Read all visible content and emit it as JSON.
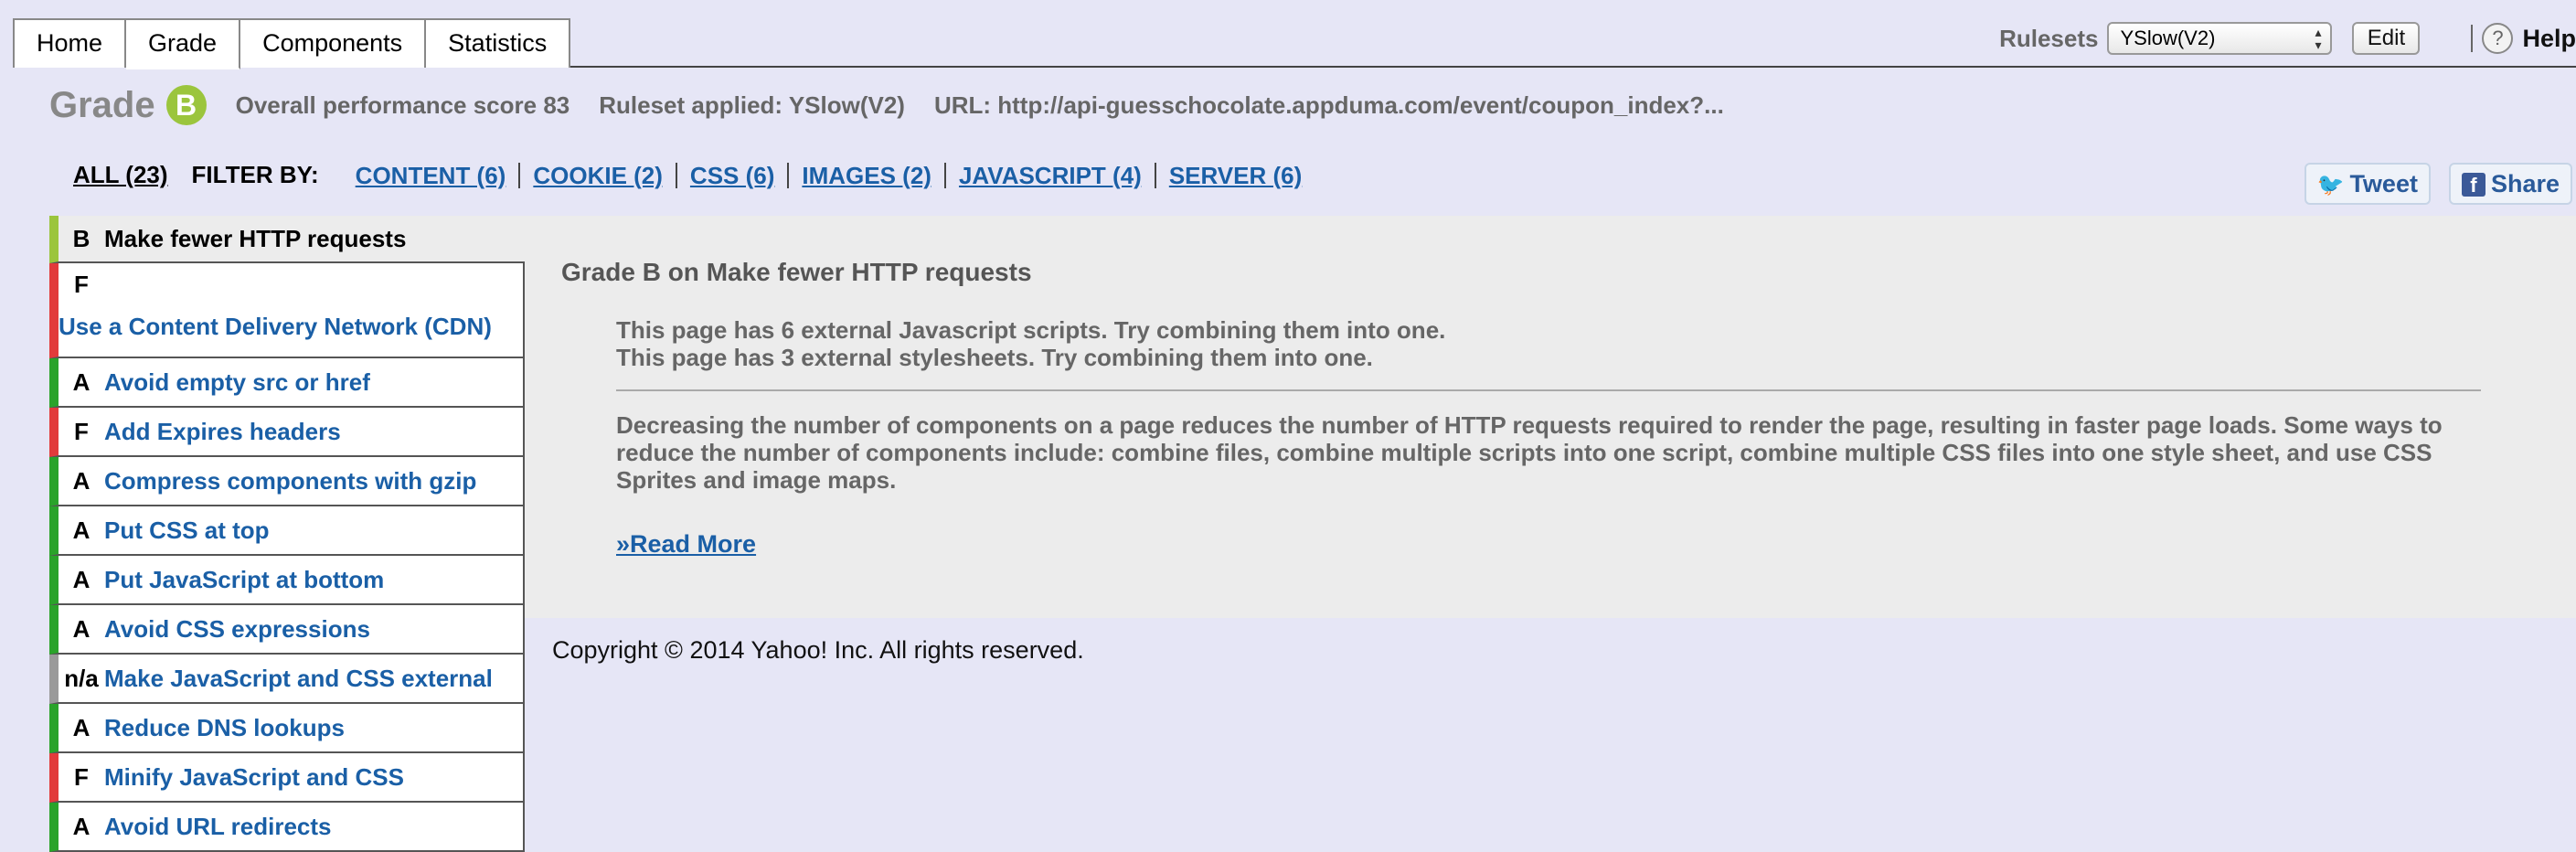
{
  "nav": {
    "tabs": [
      {
        "label": "Home"
      },
      {
        "label": "Grade"
      },
      {
        "label": "Components"
      },
      {
        "label": "Statistics"
      }
    ],
    "rulesets_label": "Rulesets",
    "ruleset_selected": "YSlow(V2)",
    "edit_label": "Edit",
    "help_icon": "?",
    "help_label": "Help"
  },
  "summary": {
    "grade_word": "Grade",
    "grade_letter": "B",
    "overall": "Overall performance score 83",
    "ruleset": "Ruleset applied: YSlow(V2)",
    "url": "URL: http://api-guesschocolate.appduma.com/event/coupon_index?..."
  },
  "filters": {
    "all": "ALL (23)",
    "filter_by": "FILTER BY:",
    "links": [
      {
        "label": "CONTENT (6)"
      },
      {
        "label": "COOKIE (2)"
      },
      {
        "label": "CSS (6)"
      },
      {
        "label": "IMAGES (2)"
      },
      {
        "label": "JAVASCRIPT (4)"
      },
      {
        "label": "SERVER (6)"
      }
    ]
  },
  "share": {
    "tweet": "Tweet",
    "share": "Share"
  },
  "rules": [
    {
      "grade": "B",
      "label": "Make fewer HTTP requests",
      "color": "#9bc53d"
    },
    {
      "grade": "F",
      "label": "Use a Content Delivery Network (CDN)",
      "color": "#e23b3b"
    },
    {
      "grade": "A",
      "label": "Avoid empty src or href",
      "color": "#2aa32a"
    },
    {
      "grade": "F",
      "label": "Add Expires headers",
      "color": "#e23b3b"
    },
    {
      "grade": "A",
      "label": "Compress components with gzip",
      "color": "#2aa32a"
    },
    {
      "grade": "A",
      "label": "Put CSS at top",
      "color": "#2aa32a"
    },
    {
      "grade": "A",
      "label": "Put JavaScript at bottom",
      "color": "#2aa32a"
    },
    {
      "grade": "A",
      "label": "Avoid CSS expressions",
      "color": "#2aa32a"
    },
    {
      "grade": "n/a",
      "label": "Make JavaScript and CSS external",
      "color": "#9a9a9a"
    },
    {
      "grade": "A",
      "label": "Reduce DNS lookups",
      "color": "#2aa32a"
    },
    {
      "grade": "F",
      "label": "Minify JavaScript and CSS",
      "color": "#e23b3b"
    },
    {
      "grade": "A",
      "label": "Avoid URL redirects",
      "color": "#2aa32a"
    }
  ],
  "detail": {
    "title": "Grade B on Make fewer HTTP requests",
    "msg1": "This page has 6 external Javascript scripts. Try combining them into one.",
    "msg2": "This page has 3 external stylesheets. Try combining them into one.",
    "description": "Decreasing the number of components on a page reduces the number of HTTP requests required to render the page, resulting in faster page loads. Some ways to reduce the number of components include: combine files, combine multiple scripts into one script, combine multiple CSS files into one style sheet, and use CSS Sprites and image maps.",
    "read_more": "»Read More"
  },
  "copyright": "Copyright © 2014 Yahoo! Inc. All rights reserved."
}
